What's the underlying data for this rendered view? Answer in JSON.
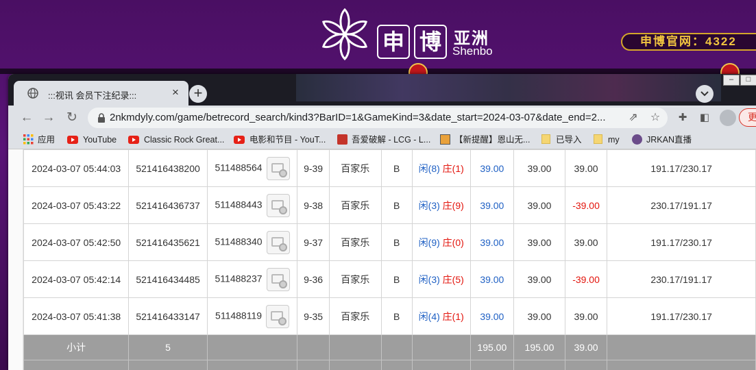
{
  "site": {
    "logo_box1": "申",
    "logo_box2": "博",
    "logo_cn": "亚洲",
    "logo_en": "Shenbo",
    "official_text": "申博官网：4322"
  },
  "browser": {
    "tab_title": ":::视讯 会员下注纪录:::",
    "tab_close": "×",
    "new_tab": "+",
    "url": "2nkmdyly.com/game/betrecord_search/kind3?BarID=1&GameKind=3&date_start=2024-03-07&date_end=2...",
    "update_label": "更"
  },
  "bookmarks": [
    {
      "label": "应用",
      "icon": "apps-grid-icon"
    },
    {
      "label": "YouTube",
      "icon": "youtube-icon"
    },
    {
      "label": "Classic Rock Great...",
      "icon": "youtube-icon"
    },
    {
      "label": "电影和节目 - YouT...",
      "icon": "youtube-icon"
    },
    {
      "label": "吾爱破解 - LCG - L...",
      "icon": "52pojie-icon"
    },
    {
      "label": "【新提醒】恩山无...",
      "icon": "right-icon"
    },
    {
      "label": "已导入",
      "icon": "folder-icon"
    },
    {
      "label": "my",
      "icon": "folder-icon"
    },
    {
      "label": "JRKAN直播",
      "icon": "jrkan-icon"
    }
  ],
  "records": [
    {
      "time": "2024-03-07 05:44:03",
      "bet_id": "521416438200",
      "round_id": "511488564",
      "table": "9-39",
      "game": "百家乐",
      "hall": "B",
      "player": "闲(8)",
      "banker": "庄(1)",
      "bet": "39.00",
      "valid": "39.00",
      "win": "39.00",
      "balance": "191.17/230.17"
    },
    {
      "time": "2024-03-07 05:43:22",
      "bet_id": "521416436737",
      "round_id": "511488443",
      "table": "9-38",
      "game": "百家乐",
      "hall": "B",
      "player": "闲(3)",
      "banker": "庄(9)",
      "bet": "39.00",
      "valid": "39.00",
      "win": "-39.00",
      "balance": "230.17/191.17"
    },
    {
      "time": "2024-03-07 05:42:50",
      "bet_id": "521416435621",
      "round_id": "511488340",
      "table": "9-37",
      "game": "百家乐",
      "hall": "B",
      "player": "闲(9)",
      "banker": "庄(0)",
      "bet": "39.00",
      "valid": "39.00",
      "win": "39.00",
      "balance": "191.17/230.17"
    },
    {
      "time": "2024-03-07 05:42:14",
      "bet_id": "521416434485",
      "round_id": "511488237",
      "table": "9-36",
      "game": "百家乐",
      "hall": "B",
      "player": "闲(3)",
      "banker": "庄(5)",
      "bet": "39.00",
      "valid": "39.00",
      "win": "-39.00",
      "balance": "230.17/191.17"
    },
    {
      "time": "2024-03-07 05:41:38",
      "bet_id": "521416433147",
      "round_id": "511488119",
      "table": "9-35",
      "game": "百家乐",
      "hall": "B",
      "player": "闲(4)",
      "banker": "庄(1)",
      "bet": "39.00",
      "valid": "39.00",
      "win": "39.00",
      "balance": "191.17/230.17"
    }
  ],
  "subtotal": {
    "label": "小计",
    "count": "5",
    "bet": "195.00",
    "valid": "195.00",
    "win": "39.00"
  },
  "colors": {
    "player": "#1f60c4",
    "banker": "#e3150d",
    "negative": "#e3150d"
  }
}
